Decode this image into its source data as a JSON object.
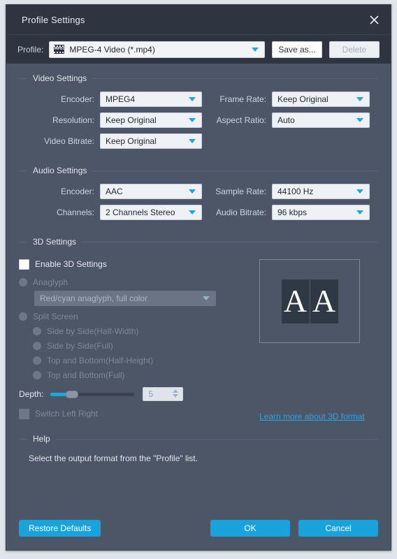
{
  "window": {
    "title": "Profile Settings",
    "close_icon": "close-icon"
  },
  "profile_bar": {
    "label": "Profile:",
    "icon": "mpeg-file-icon",
    "icon_text": "MPEG",
    "value": "MPEG-4 Video (*.mp4)",
    "save_as_label": "Save as...",
    "delete_label": "Delete"
  },
  "video_settings": {
    "legend": "Video Settings",
    "fields": [
      {
        "label": "Encoder:",
        "value": "MPEG4"
      },
      {
        "label": "Resolution:",
        "value": "Keep Original"
      },
      {
        "label": "Video Bitrate:",
        "value": "Keep Original"
      },
      {
        "label": "Frame Rate:",
        "value": "Keep Original"
      },
      {
        "label": "Aspect Ratio:",
        "value": "Auto"
      }
    ]
  },
  "audio_settings": {
    "legend": "Audio Settings",
    "fields": [
      {
        "label": "Encoder:",
        "value": "AAC"
      },
      {
        "label": "Channels:",
        "value": "2 Channels Stereo"
      },
      {
        "label": "Sample Rate:",
        "value": "44100 Hz"
      },
      {
        "label": "Audio Bitrate:",
        "value": "96 kbps"
      }
    ]
  },
  "threed_settings": {
    "legend": "3D Settings",
    "enable_label": "Enable 3D Settings",
    "anaglyph_label": "Anaglyph",
    "anaglyph_value": "Red/cyan anaglyph, full color",
    "split_screen_label": "Split Screen",
    "split_options": [
      "Side by Side(Half-Width)",
      "Side by Side(Full)",
      "Top and Bottom(Half-Height)",
      "Top and Bottom(Full)"
    ],
    "depth_label": "Depth:",
    "depth_value": "5",
    "switch_label": "Switch Left Right",
    "learn_more": "Learn more about 3D format",
    "preview_left_glyph": "A",
    "preview_right_glyph": "A"
  },
  "help": {
    "legend": "Help",
    "text": "Select the output format from the \"Profile\" list."
  },
  "footer": {
    "restore_label": "Restore Defaults",
    "ok_label": "OK",
    "cancel_label": "Cancel"
  },
  "colors": {
    "accent": "#19a3dd",
    "window_bg": "#4c5666",
    "titlebar_bg": "#2e3440",
    "link": "#2ea3e0"
  }
}
